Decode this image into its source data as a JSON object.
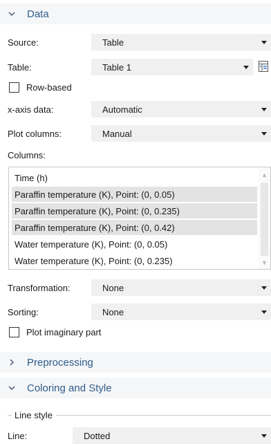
{
  "sections": {
    "data": {
      "title": "Data",
      "expanded": true
    },
    "preprocessing": {
      "title": "Preprocessing",
      "expanded": false
    },
    "coloring": {
      "title": "Coloring and Style",
      "expanded": true
    }
  },
  "fields": {
    "source": {
      "label": "Source:",
      "value": "Table"
    },
    "table": {
      "label": "Table:",
      "value": "Table 1"
    },
    "row_based": {
      "label": "Row-based",
      "checked": false
    },
    "x_axis": {
      "label": "x-axis data:",
      "value": "Automatic"
    },
    "plot_columns": {
      "label": "Plot columns:",
      "value": "Manual"
    },
    "columns_label": "Columns:",
    "transformation": {
      "label": "Transformation:",
      "value": "None"
    },
    "sorting": {
      "label": "Sorting:",
      "value": "None"
    },
    "plot_imaginary": {
      "label": "Plot imaginary part",
      "checked": false
    }
  },
  "columns": [
    {
      "text": "Time (h)",
      "selected": false
    },
    {
      "text": "Paraffin temperature (K), Point: (0, 0.05)",
      "selected": true
    },
    {
      "text": "Paraffin temperature (K), Point: (0, 0.235)",
      "selected": true
    },
    {
      "text": "Paraffin temperature (K), Point: (0, 0.42)",
      "selected": true
    },
    {
      "text": "Water temperature (K), Point: (0, 0.05)",
      "selected": false
    },
    {
      "text": "Water temperature (K), Point: (0, 0.235)",
      "selected": false
    }
  ],
  "line_style": {
    "group_title": "Line style",
    "line": {
      "label": "Line:",
      "value": "Dotted"
    }
  },
  "icons": {
    "chevron_down": "chevron-down-icon",
    "chevron_right": "chevron-right-icon",
    "dropdown_arrow": "dropdown-arrow-icon",
    "table_settings": "table-settings-icon"
  },
  "colors": {
    "section_title": "#2e5c8a",
    "section_bg": "#f5f6f8",
    "combo_bg": "#f0f0f0",
    "selected_row": "#e3e3e3",
    "table_icon_accent": "#2a6ebb"
  }
}
